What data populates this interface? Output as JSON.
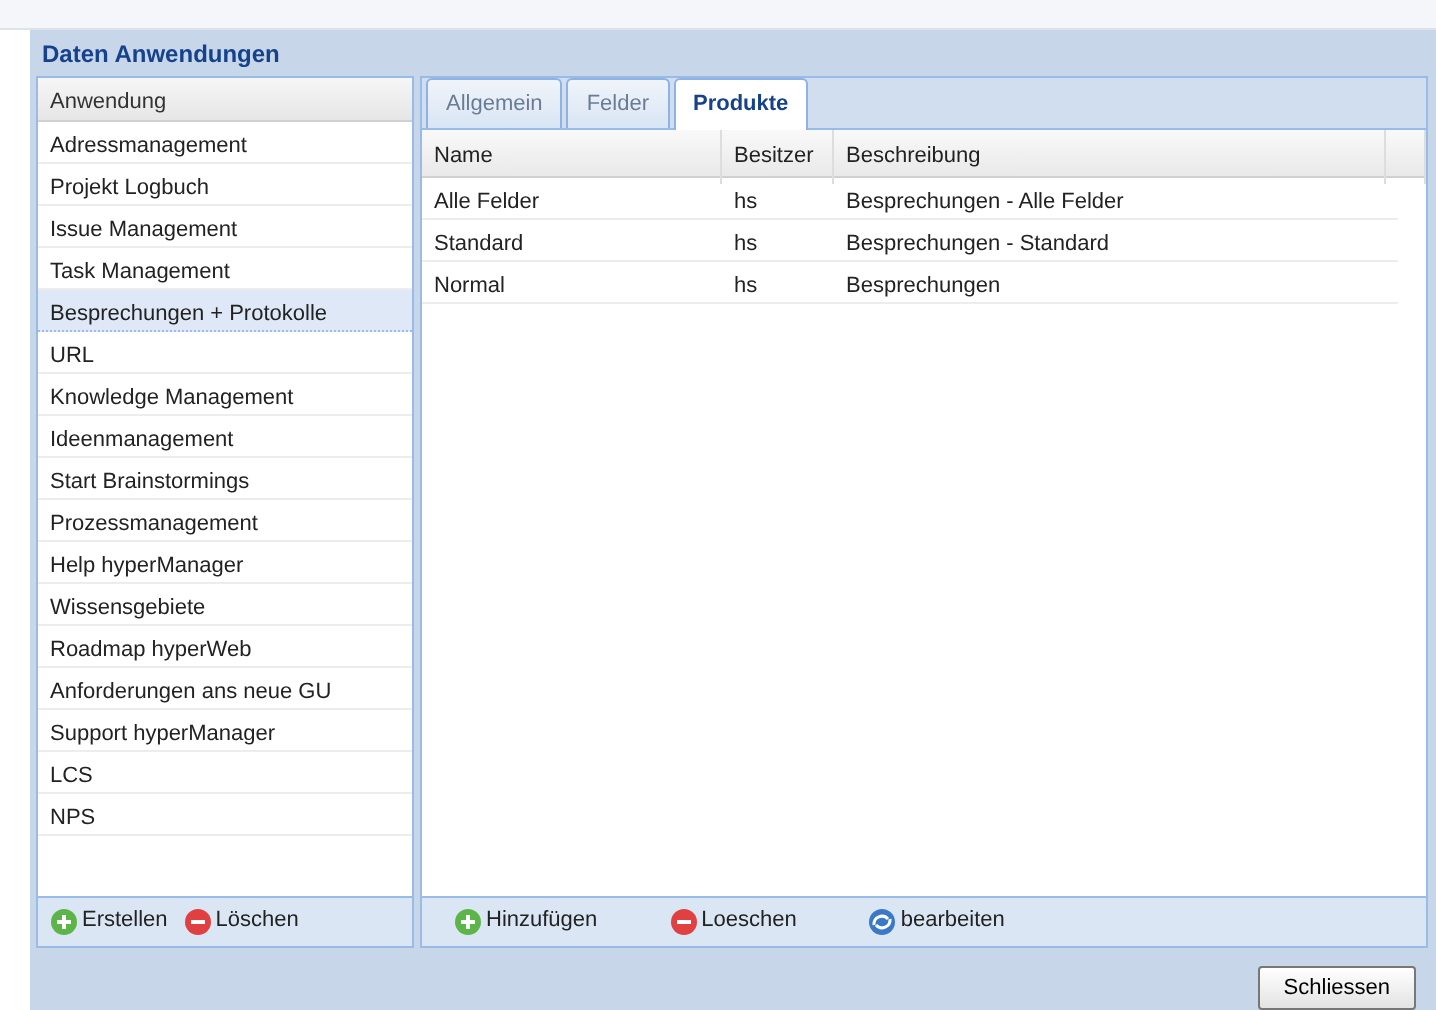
{
  "window": {
    "title": "Daten Anwendungen"
  },
  "sidebar": {
    "header": "Anwendung",
    "items": [
      {
        "label": "Adressmanagement",
        "selected": false
      },
      {
        "label": "Projekt Logbuch",
        "selected": false
      },
      {
        "label": "Issue Management",
        "selected": false
      },
      {
        "label": "Task Management",
        "selected": false
      },
      {
        "label": "Besprechungen + Protokolle",
        "selected": true
      },
      {
        "label": "URL",
        "selected": false
      },
      {
        "label": "Knowledge Management",
        "selected": false
      },
      {
        "label": "Ideenmanagement",
        "selected": false
      },
      {
        "label": "Start Brainstormings",
        "selected": false
      },
      {
        "label": "Prozessmanagement",
        "selected": false
      },
      {
        "label": "Help hyperManager",
        "selected": false
      },
      {
        "label": "Wissensgebiete",
        "selected": false
      },
      {
        "label": "Roadmap hyperWeb",
        "selected": false
      },
      {
        "label": "Anforderungen ans neue GU",
        "selected": false
      },
      {
        "label": "Support hyperManager",
        "selected": false
      },
      {
        "label": "LCS",
        "selected": false
      },
      {
        "label": "NPS",
        "selected": false
      }
    ],
    "toolbar": [
      {
        "kind": "add",
        "label": "Erstellen"
      },
      {
        "kind": "delete",
        "label": "Löschen"
      }
    ]
  },
  "tabs": [
    {
      "label": "Allgemein",
      "selected": false
    },
    {
      "label": "Felder",
      "selected": false
    },
    {
      "label": "Produkte",
      "selected": true
    }
  ],
  "table": {
    "columns": [
      "Name",
      "Besitzer",
      "Beschreibung"
    ],
    "rows": [
      [
        "Alle Felder",
        "hs",
        "Besprechungen - Alle Felder"
      ],
      [
        "Standard",
        "hs",
        "Besprechungen - Standard"
      ],
      [
        "Normal",
        "hs",
        "Besprechungen"
      ]
    ]
  },
  "toolbar": [
    {
      "kind": "add",
      "label": "Hinzufügen"
    },
    {
      "kind": "delete",
      "label": "Loeschen"
    },
    {
      "kind": "edit",
      "label": "bearbeiten"
    }
  ],
  "buttons": [
    "Schliessen"
  ]
}
